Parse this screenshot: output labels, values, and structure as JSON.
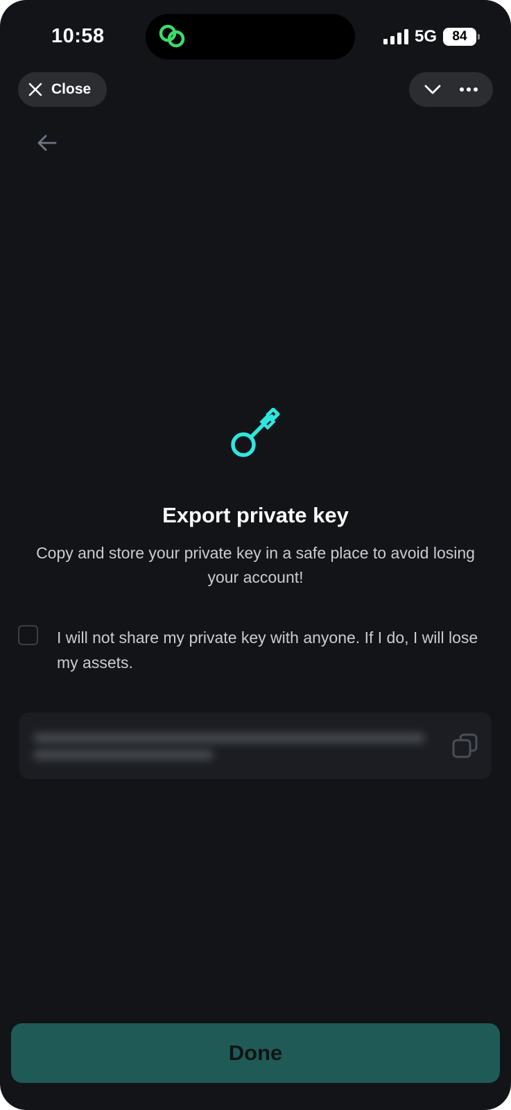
{
  "status_bar": {
    "time": "10:58",
    "network": "5G",
    "battery": "84",
    "island_icon": "link-icon",
    "island_icon_color": "#3ddc6a"
  },
  "header": {
    "close_label": "Close",
    "close_icon": "close-icon",
    "collapse_icon": "chevron-down-icon",
    "more_icon": "more-horizontal-icon",
    "back_icon": "arrow-left-icon"
  },
  "content": {
    "icon": "key-icon",
    "icon_color": "#2ee6e0",
    "title": "Export private key",
    "subtitle": "Copy and store your private key in a safe place to avoid losing your account!",
    "checkbox": {
      "checked": false,
      "label": "I will not share my private key with anyone. If I do, I will lose my assets."
    },
    "private_key": {
      "masked": true,
      "copy_icon": "copy-icon"
    }
  },
  "footer": {
    "done_label": "Done",
    "done_color": "#1f5a56"
  }
}
